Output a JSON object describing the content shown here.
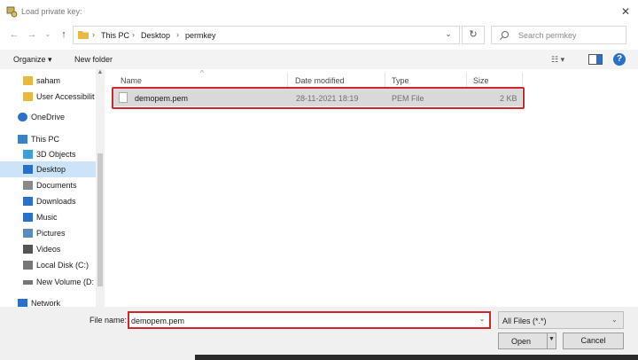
{
  "window": {
    "title": "Load private key:",
    "close_glyph": "✕"
  },
  "address": {
    "path": [
      "This PC",
      "Desktop",
      "permkey"
    ],
    "separator": "›"
  },
  "search": {
    "placeholder": "Search permkey"
  },
  "toolbar": {
    "organize": "Organize ▾",
    "new_folder": "New folder"
  },
  "sidebar": {
    "items": [
      {
        "label": "saham",
        "icon": "folder-icon"
      },
      {
        "label": "User Accessibilit",
        "icon": "folder-icon"
      },
      {
        "label": "OneDrive",
        "icon": "cloud-icon"
      },
      {
        "label": "This PC",
        "icon": "computer-icon"
      },
      {
        "label": "3D Objects",
        "icon": "cube-icon"
      },
      {
        "label": "Desktop",
        "icon": "desktop-icon",
        "selected": true
      },
      {
        "label": "Documents",
        "icon": "document-icon"
      },
      {
        "label": "Downloads",
        "icon": "download-icon"
      },
      {
        "label": "Music",
        "icon": "music-icon"
      },
      {
        "label": "Pictures",
        "icon": "picture-icon"
      },
      {
        "label": "Videos",
        "icon": "video-icon"
      },
      {
        "label": "Local Disk (C:)",
        "icon": "disk-icon"
      },
      {
        "label": "New Volume (D:",
        "icon": "drive-icon"
      },
      {
        "label": "Network",
        "icon": "network-icon"
      }
    ]
  },
  "columns": {
    "name": "Name",
    "date": "Date modified",
    "type": "Type",
    "size": "Size"
  },
  "files": [
    {
      "name": "demopem.pem",
      "date": "28-11-2021 18:19",
      "type": "PEM File",
      "size": "2 KB"
    }
  ],
  "bottom": {
    "file_name_label": "File name:",
    "file_name_value": "demopem.pem",
    "file_type": "All Files (*.*)",
    "open": "Open",
    "cancel": "Cancel"
  },
  "colors": {
    "accent": "#2a6fc9",
    "highlight_outline": "#d1262c",
    "selected": "#cce4f7",
    "folder": "#e8b844"
  }
}
